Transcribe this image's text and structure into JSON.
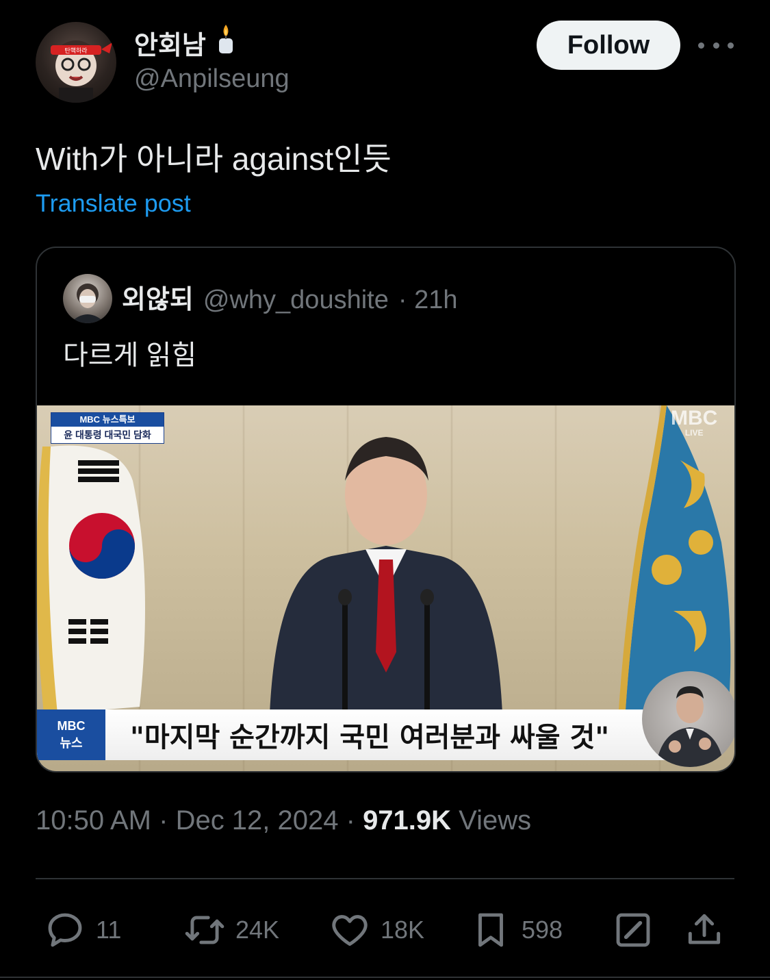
{
  "author": {
    "display_name": "안회남",
    "handle": "@Anpilseung",
    "avatar_badge": "탄핵하라"
  },
  "follow_label": "Follow",
  "tweet": {
    "text": "With가 아니라 against인듯",
    "translate_label": "Translate post"
  },
  "quote": {
    "name": "외않되",
    "handle": "@why_doushite",
    "time": "· 21h",
    "text": "다르게 읽힘",
    "media": {
      "tag_top": "MBC 뉴스특보",
      "tag_bottom": "윤 대통령 대국민 담화",
      "corner_logo": "MBC",
      "corner_live": "LIVE",
      "caption_logo_top": "MBC",
      "caption_logo_bottom": "뉴스",
      "caption": "\"마지막 순간까지 국민 여러분과 싸울 것\""
    }
  },
  "meta": {
    "time": "10:50 AM",
    "sep1": " · ",
    "date": "Dec 12, 2024",
    "sep2": " · ",
    "views_count": "971.9K",
    "views_label": " Views"
  },
  "actions": {
    "replies": "11",
    "reposts": "24K",
    "likes": "18K",
    "bookmarks": "598"
  },
  "icons": [
    "more-icon",
    "candle-icon",
    "reply-icon",
    "repost-icon",
    "like-icon",
    "bookmark-icon",
    "grok-icon",
    "share-icon"
  ],
  "colors": {
    "background": "#000000",
    "text": "#e7e9ea",
    "muted": "#71767b",
    "link": "#1d9bf0",
    "border": "#2f3336"
  }
}
